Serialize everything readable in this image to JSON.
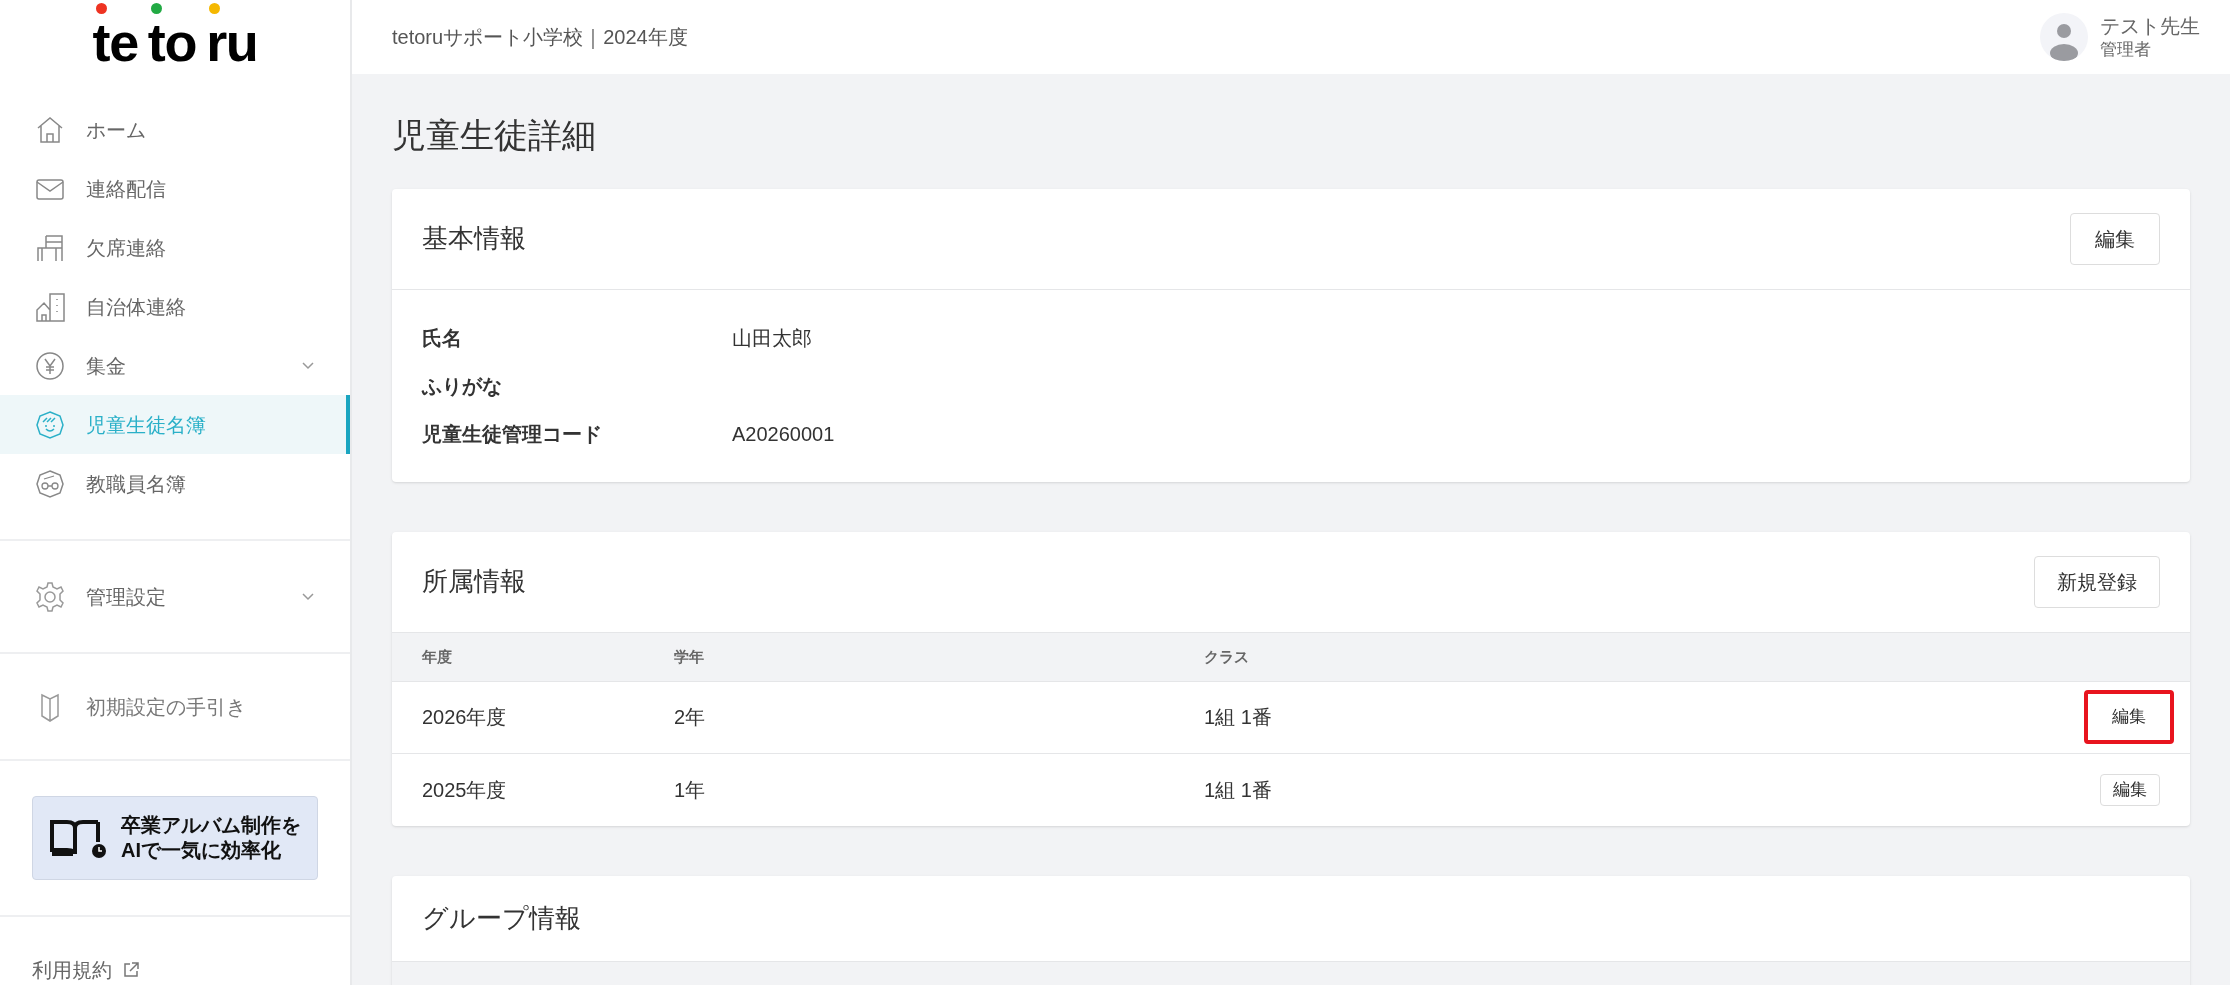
{
  "logo": {
    "letters": [
      {
        "text": "te"
      },
      {
        "text": "to"
      },
      {
        "text": "ru"
      }
    ]
  },
  "sidebar": {
    "items": [
      {
        "label": "ホーム",
        "kind": "home",
        "selected": false,
        "expandable": false
      },
      {
        "label": "連絡配信",
        "kind": "mail",
        "selected": false,
        "expandable": false
      },
      {
        "label": "欠席連絡",
        "kind": "chair",
        "selected": false,
        "expandable": false
      },
      {
        "label": "自治体連絡",
        "kind": "building",
        "selected": false,
        "expandable": false
      },
      {
        "label": "集金",
        "kind": "yen",
        "selected": false,
        "expandable": true
      },
      {
        "label": "児童生徒名簿",
        "kind": "child",
        "selected": true,
        "expandable": false
      },
      {
        "label": "教職員名簿",
        "kind": "teacher",
        "selected": false,
        "expandable": false
      }
    ],
    "settings": {
      "label": "管理設定",
      "expandable": true
    },
    "guide": {
      "label": "初期設定の手引き"
    },
    "banner": {
      "lines": [
        "卒業アルバム制作を",
        "AIで一気に効率化"
      ]
    },
    "terms": {
      "label": "利用規約"
    }
  },
  "header": {
    "school": "tetoruサポート小学校｜2024年度",
    "user": {
      "name": "テスト先生",
      "role": "管理者"
    }
  },
  "page_title": "児童生徒詳細",
  "basic_info": {
    "title": "基本情報",
    "button": "編集",
    "fields": [
      {
        "label": "氏名",
        "value": "山田太郎"
      },
      {
        "label": "ふりがな"
      },
      {
        "label": "児童生徒管理コード",
        "value": "A20260001"
      }
    ]
  },
  "affiliation": {
    "title": "所属情報",
    "button": "新規登録",
    "columns": [
      "年度",
      "学年",
      "クラス"
    ],
    "rows": [
      {
        "year": "2026年度",
        "grade": "2年",
        "class": "1組 1番",
        "button": "編集",
        "highlighted": true
      },
      {
        "year": "2025年度",
        "grade": "1年",
        "class": "1組 1番",
        "button": "編集",
        "highlighted": false
      }
    ]
  },
  "group_info": {
    "title": "グループ情報"
  }
}
